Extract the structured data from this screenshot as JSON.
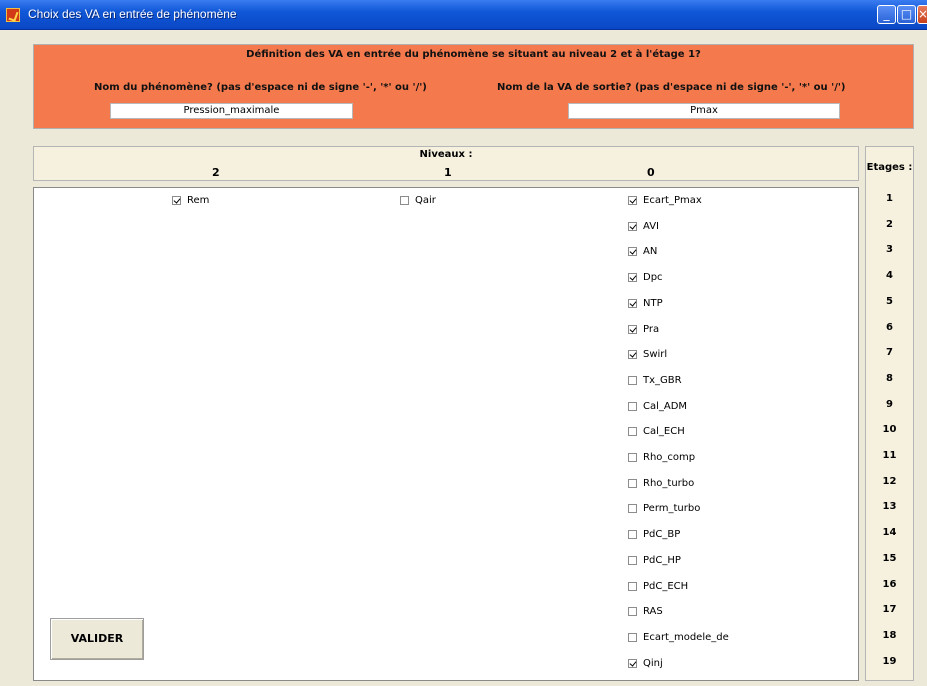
{
  "window": {
    "title": "Choix des VA en entrée de phénomène"
  },
  "header": {
    "definition_title": "Définition des VA en entrée du phénomène se situant au niveau 2 et à l'étage 1?",
    "phenomene_label": "Nom du phénomène? (pas d'espace ni de signe '-', '*' ou '/')",
    "phenomene_value": "Pression_maximale",
    "sortie_label": "Nom de la VA de sortie? (pas d'espace ni de signe '-', '*' ou '/')",
    "sortie_value": "Pmax"
  },
  "niveaux": {
    "title": "Niveaux :",
    "levels": [
      "2",
      "1",
      "0"
    ]
  },
  "etages": {
    "title": "Etages :",
    "numbers": [
      "1",
      "2",
      "3",
      "4",
      "5",
      "6",
      "7",
      "8",
      "9",
      "10",
      "11",
      "12",
      "13",
      "14",
      "15",
      "16",
      "17",
      "18",
      "19"
    ]
  },
  "level2": [
    {
      "label": "Rem",
      "checked": true
    }
  ],
  "level1": [
    {
      "label": "Qair",
      "checked": false
    }
  ],
  "level0": [
    {
      "label": "Ecart_Pmax",
      "checked": true
    },
    {
      "label": "AVI",
      "checked": true
    },
    {
      "label": "AN",
      "checked": true
    },
    {
      "label": "Dpc",
      "checked": true
    },
    {
      "label": "NTP",
      "checked": true
    },
    {
      "label": "Pra",
      "checked": true
    },
    {
      "label": "Swirl",
      "checked": true
    },
    {
      "label": "Tx_GBR",
      "checked": false
    },
    {
      "label": "Cal_ADM",
      "checked": false
    },
    {
      "label": "Cal_ECH",
      "checked": false
    },
    {
      "label": "Rho_comp",
      "checked": false
    },
    {
      "label": "Rho_turbo",
      "checked": false
    },
    {
      "label": "Perm_turbo",
      "checked": false
    },
    {
      "label": "PdC_BP",
      "checked": false
    },
    {
      "label": "PdC_HP",
      "checked": false
    },
    {
      "label": "PdC_ECH",
      "checked": false
    },
    {
      "label": "RAS",
      "checked": false
    },
    {
      "label": "Ecart_modele_de",
      "checked": false
    },
    {
      "label": "Qinj",
      "checked": true
    }
  ],
  "actions": {
    "valider_label": "VALIDER"
  }
}
